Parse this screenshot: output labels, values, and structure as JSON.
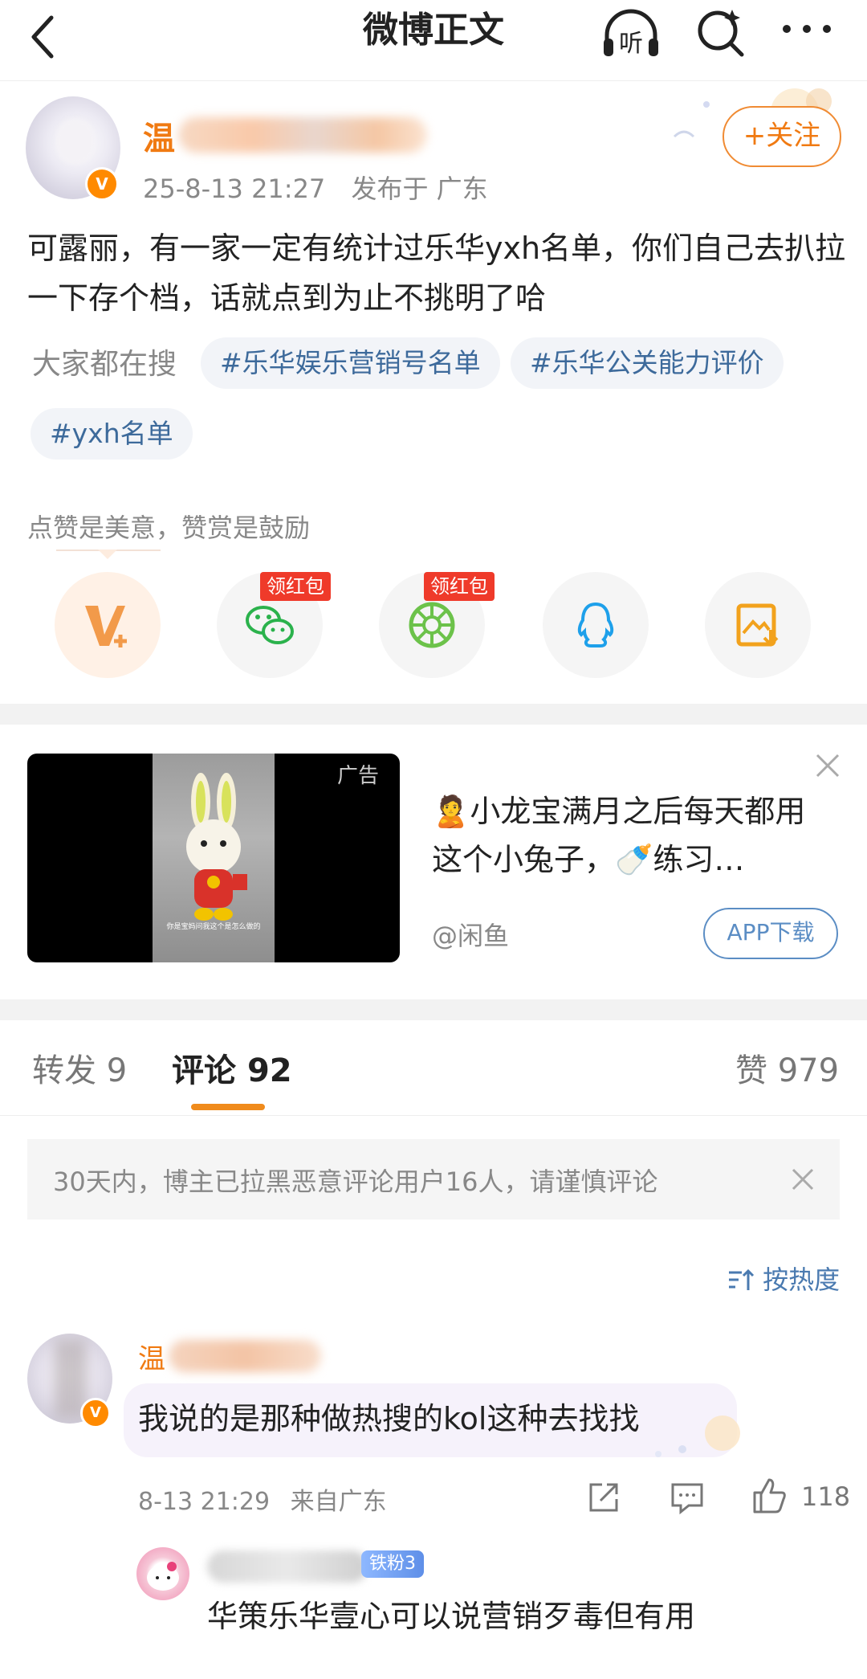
{
  "topbar": {
    "title": "微博正文",
    "listen_label": "听"
  },
  "post": {
    "author_name": "温婼",
    "author_name_first_char": "温",
    "verified_mark": "V",
    "date": "25-8-13 21:27",
    "location": "发布于 广东",
    "follow_label": "+关注",
    "text": "可露丽，有一家一定有统计过乐华yxh名单，你们自己去扒拉一下存个档，话就点到为止不挑明了哈",
    "search_label": "大家都在搜",
    "tags": [
      "#乐华娱乐营销号名单",
      "#乐华公关能力评价",
      "#yxh名单"
    ],
    "reward_tip": "点赞是美意，赞赏是鼓励",
    "share_badges": [
      "领红包",
      "领红包"
    ]
  },
  "ad": {
    "label": "广告",
    "title": "🙎小龙宝满月之后每天都用这个小兔子，🍼练习…",
    "source": "@闲鱼",
    "download_label": "APP下载",
    "video_caption": "你是宝妈问我这个是怎么做的"
  },
  "tabs": {
    "repost_label": "转发",
    "repost_count": "9",
    "comment_label": "评论",
    "comment_count": "92",
    "like_label": "赞",
    "like_count": "979"
  },
  "notice": {
    "text": "30天内，博主已拉黑恶意评论用户16人，请谨慎评论"
  },
  "sort": {
    "label": "按热度"
  },
  "comment": {
    "author_first_char": "温",
    "text": "我说的是那种做热搜的kol这种去找找",
    "date": "8-13 21:29",
    "location": "来自广东",
    "like_count": "118"
  },
  "reply": {
    "badge": "铁粉3",
    "text": "华策乐华壹心可以说营销歹毒但有用"
  },
  "colors": {
    "accent_orange": "#f07a12",
    "link_blue": "#3d6a9b",
    "red_badge": "#ef3a2a"
  }
}
